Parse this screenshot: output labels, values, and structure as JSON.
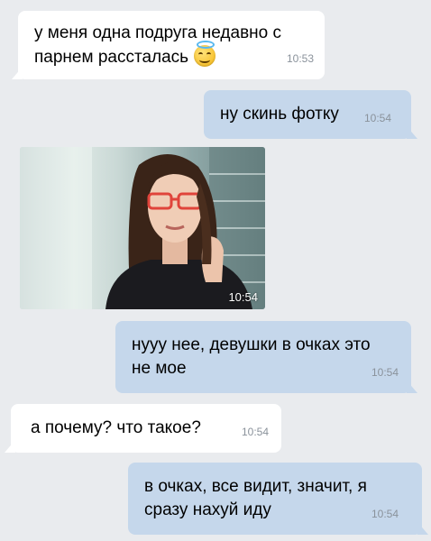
{
  "messages": [
    {
      "id": "m1",
      "direction": "incoming",
      "text": "у меня одна подруга недавно с\nпарнем рассталась",
      "emoji_icon": "innocent-smile-emoji",
      "time": "10:53"
    },
    {
      "id": "m2",
      "direction": "outgoing",
      "text": "ну скинь фотку",
      "time": "10:54"
    },
    {
      "id": "m3",
      "direction": "incoming",
      "type": "photo",
      "photo_description_icon": "woman-with-glasses-photo",
      "time": "10:54"
    },
    {
      "id": "m4",
      "direction": "outgoing",
      "text": "нууу нее, девушки в очках это\nне мое",
      "time": "10:54"
    },
    {
      "id": "m5",
      "direction": "incoming",
      "text": "а почему? что такое?",
      "time": "10:54"
    },
    {
      "id": "m6",
      "direction": "outgoing",
      "text": "в очках, все видит, значит, я\nсразу нахуй иду",
      "time": "10:54"
    }
  ],
  "colors": {
    "background": "#e9ebee",
    "incoming_bubble": "#ffffff",
    "outgoing_bubble": "#c5d7eb",
    "timestamp": "#8a929b"
  }
}
